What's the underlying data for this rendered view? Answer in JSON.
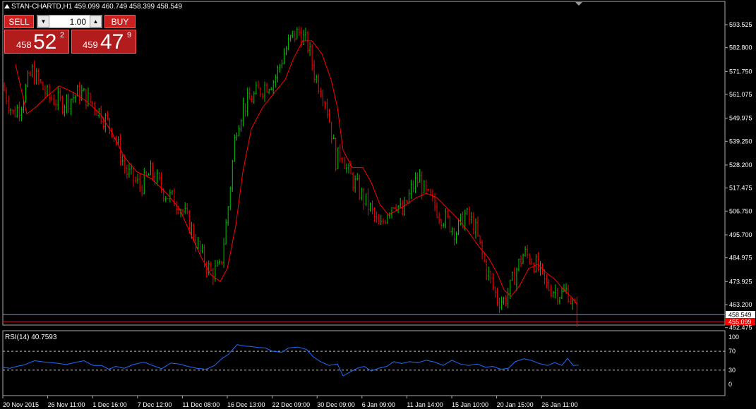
{
  "window": {
    "title": "STAN-CHARTD,H1  459.099 460.749 458.399 458.549"
  },
  "trade_panel": {
    "sell_label": "SELL",
    "buy_label": "BUY",
    "lot_value": "1.00",
    "sell_quote": {
      "prefix": "458",
      "big": "52",
      "sup": "2"
    },
    "buy_quote": {
      "prefix": "459",
      "big": "47",
      "sup": "9"
    }
  },
  "rsi": {
    "label": "RSI(14) 40.7593"
  },
  "colors": {
    "bull": "#00c800",
    "bear": "#ff0000",
    "ma": "#ff0000",
    "rsi": "#1e6cff",
    "grid": "#aaaaaa",
    "bid_line": "#8c9aa8",
    "ask_line": "#ff0000"
  },
  "chart_data": {
    "type": "candlestick",
    "symbol": "STAN-CHARTD",
    "timeframe": "H1",
    "last": {
      "open": 459.099,
      "high": 460.749,
      "low": 458.399,
      "close": 458.549
    },
    "price_ticks": [
      "593.525",
      "582.800",
      "571.750",
      "561.075",
      "549.975",
      "539.250",
      "528.200",
      "517.475",
      "506.750",
      "495.700",
      "484.975",
      "473.925",
      "463.200",
      "452.475"
    ],
    "price_range": [
      449.5,
      598.5
    ],
    "bid_price": "458.549",
    "ask_price": "455.099",
    "time_labels": [
      "20 Nov 2015",
      "26 Nov 11:00",
      "1 Dec 16:00",
      "7 Dec 12:00",
      "11 Dec 08:00",
      "16 Dec 13:00",
      "22 Dec 09:00",
      "30 Dec 09:00",
      "6 Jan 09:00",
      "11 Jan 14:00",
      "15 Jan 10:00",
      "20 Jan 15:00",
      "26 Jan 11:00"
    ],
    "close_path": [
      [
        0,
        565
      ],
      [
        14,
        552
      ],
      [
        25,
        556
      ],
      [
        41,
        572
      ],
      [
        64,
        560
      ],
      [
        84,
        557
      ],
      [
        110,
        562
      ],
      [
        130,
        556
      ],
      [
        155,
        545
      ],
      [
        175,
        525
      ],
      [
        195,
        518
      ],
      [
        210,
        525
      ],
      [
        230,
        515
      ],
      [
        250,
        510
      ],
      [
        265,
        500
      ],
      [
        280,
        487
      ],
      [
        295,
        478
      ],
      [
        308,
        480
      ],
      [
        318,
        505
      ],
      [
        330,
        545
      ],
      [
        340,
        555
      ],
      [
        355,
        560
      ],
      [
        370,
        565
      ],
      [
        385,
        568
      ],
      [
        398,
        580
      ],
      [
        410,
        588
      ],
      [
        420,
        590
      ],
      [
        432,
        584
      ],
      [
        442,
        570
      ],
      [
        456,
        560
      ],
      [
        465,
        545
      ],
      [
        472,
        530
      ],
      [
        480,
        535
      ],
      [
        488,
        525
      ],
      [
        498,
        520
      ],
      [
        510,
        513
      ],
      [
        522,
        507
      ],
      [
        534,
        498
      ],
      [
        545,
        507
      ],
      [
        556,
        512
      ],
      [
        566,
        505
      ],
      [
        580,
        518
      ],
      [
        590,
        522
      ],
      [
        598,
        515
      ],
      [
        610,
        510
      ],
      [
        620,
        505
      ],
      [
        630,
        502
      ],
      [
        642,
        497
      ],
      [
        655,
        505
      ],
      [
        668,
        500
      ],
      [
        680,
        485
      ],
      [
        690,
        475
      ],
      [
        700,
        466
      ],
      [
        710,
        465
      ],
      [
        718,
        470
      ],
      [
        728,
        480
      ],
      [
        738,
        487
      ],
      [
        748,
        485
      ],
      [
        758,
        480
      ],
      [
        770,
        472
      ],
      [
        782,
        470
      ],
      [
        792,
        468
      ],
      [
        800,
        470
      ],
      [
        808,
        462
      ],
      [
        814,
        458.549
      ]
    ],
    "ma_path": [
      [
        18,
        575
      ],
      [
        25,
        565
      ],
      [
        34,
        552
      ],
      [
        46,
        555
      ],
      [
        62,
        560
      ],
      [
        80,
        565
      ],
      [
        100,
        562
      ],
      [
        118,
        558
      ],
      [
        138,
        552
      ],
      [
        155,
        543
      ],
      [
        172,
        532
      ],
      [
        190,
        525
      ],
      [
        210,
        522
      ],
      [
        232,
        515
      ],
      [
        250,
        508
      ],
      [
        265,
        497
      ],
      [
        280,
        486
      ],
      [
        295,
        477
      ],
      [
        308,
        474
      ],
      [
        318,
        480
      ],
      [
        330,
        500
      ],
      [
        340,
        525
      ],
      [
        352,
        545
      ],
      [
        368,
        555
      ],
      [
        385,
        562
      ],
      [
        400,
        568
      ],
      [
        412,
        578
      ],
      [
        425,
        586
      ],
      [
        438,
        586
      ],
      [
        452,
        580
      ],
      [
        465,
        568
      ],
      [
        474,
        555
      ],
      [
        482,
        535
      ],
      [
        495,
        527
      ],
      [
        510,
        527
      ],
      [
        522,
        520
      ],
      [
        534,
        510
      ],
      [
        546,
        505
      ],
      [
        558,
        507
      ],
      [
        572,
        510
      ],
      [
        586,
        513
      ],
      [
        600,
        515
      ],
      [
        615,
        513
      ],
      [
        630,
        508
      ],
      [
        645,
        503
      ],
      [
        660,
        497
      ],
      [
        675,
        490
      ],
      [
        688,
        485
      ],
      [
        700,
        478
      ],
      [
        710,
        470
      ],
      [
        720,
        467
      ],
      [
        732,
        472
      ],
      [
        745,
        480
      ],
      [
        758,
        482
      ],
      [
        770,
        478
      ],
      [
        782,
        475
      ],
      [
        795,
        470
      ],
      [
        805,
        467
      ],
      [
        814,
        463
      ]
    ],
    "rsi": {
      "name": "RSI(14)",
      "last": 40.7593,
      "ticks": [
        "100",
        "70",
        "30",
        "0"
      ],
      "levels": [
        70,
        30
      ],
      "path": [
        [
          0,
          36
        ],
        [
          10,
          34
        ],
        [
          20,
          38
        ],
        [
          30,
          41
        ],
        [
          45,
          50
        ],
        [
          60,
          47
        ],
        [
          75,
          45
        ],
        [
          90,
          42
        ],
        [
          105,
          47
        ],
        [
          115,
          50
        ],
        [
          128,
          40
        ],
        [
          140,
          40
        ],
        [
          150,
          32
        ],
        [
          160,
          38
        ],
        [
          172,
          34
        ],
        [
          185,
          42
        ],
        [
          200,
          47
        ],
        [
          212,
          40
        ],
        [
          225,
          33
        ],
        [
          238,
          45
        ],
        [
          250,
          43
        ],
        [
          262,
          38
        ],
        [
          275,
          34
        ],
        [
          288,
          32
        ],
        [
          300,
          40
        ],
        [
          310,
          54
        ],
        [
          320,
          64
        ],
        [
          332,
          84
        ],
        [
          342,
          81
        ],
        [
          352,
          80
        ],
        [
          362,
          78
        ],
        [
          372,
          77
        ],
        [
          382,
          70
        ],
        [
          395,
          68
        ],
        [
          405,
          77
        ],
        [
          418,
          79
        ],
        [
          430,
          74
        ],
        [
          440,
          58
        ],
        [
          450,
          48
        ],
        [
          462,
          40
        ],
        [
          474,
          43
        ],
        [
          482,
          18
        ],
        [
          492,
          26
        ],
        [
          502,
          34
        ],
        [
          512,
          38
        ],
        [
          522,
          28
        ],
        [
          532,
          34
        ],
        [
          544,
          38
        ],
        [
          554,
          48
        ],
        [
          565,
          44
        ],
        [
          576,
          48
        ],
        [
          588,
          46
        ],
        [
          600,
          51
        ],
        [
          612,
          47
        ],
        [
          624,
          40
        ],
        [
          636,
          51
        ],
        [
          648,
          43
        ],
        [
          660,
          40
        ],
        [
          672,
          43
        ],
        [
          684,
          36
        ],
        [
          694,
          38
        ],
        [
          706,
          32
        ],
        [
          716,
          34
        ],
        [
          726,
          48
        ],
        [
          738,
          54
        ],
        [
          748,
          51
        ],
        [
          760,
          44
        ],
        [
          772,
          40
        ],
        [
          782,
          46
        ],
        [
          792,
          40
        ],
        [
          800,
          55
        ],
        [
          808,
          40
        ],
        [
          816,
          40.7593
        ]
      ]
    }
  }
}
